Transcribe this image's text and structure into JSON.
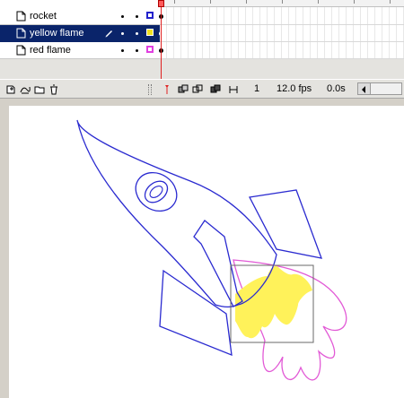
{
  "timeline": {
    "layers": [
      {
        "name": "rocket",
        "selected": false,
        "outline_color": "#2222cc"
      },
      {
        "name": "yellow flame",
        "selected": true,
        "outline_color": "#f0e020"
      },
      {
        "name": "red flame",
        "selected": false,
        "outline_color": "#e040e0"
      }
    ],
    "status": {
      "current_frame": "1",
      "frame_rate": "12.0 fps",
      "elapsed_time": "0.0s"
    }
  },
  "colors": {
    "selection": "#0a246a",
    "rocket_stroke": "#2a2ad0",
    "yellow_fill": "#fff25a",
    "red_flame_stroke": "#e25ad6",
    "playhead": "#e02020"
  },
  "icons": {
    "layer": "page-fold-icon",
    "pencil": "pencil-icon",
    "insert_layer": "insert-layer-icon",
    "motion_guide": "motion-guide-icon",
    "insert_folder": "folder-icon",
    "delete_layer": "trash-icon",
    "center_frame": "center-frame-icon",
    "onion_skin": "onion-skin-icon",
    "onion_skin_outlines": "onion-outline-icon",
    "edit_multiple_frames": "edit-multiple-icon",
    "onion_markers": "onion-markers-icon"
  }
}
